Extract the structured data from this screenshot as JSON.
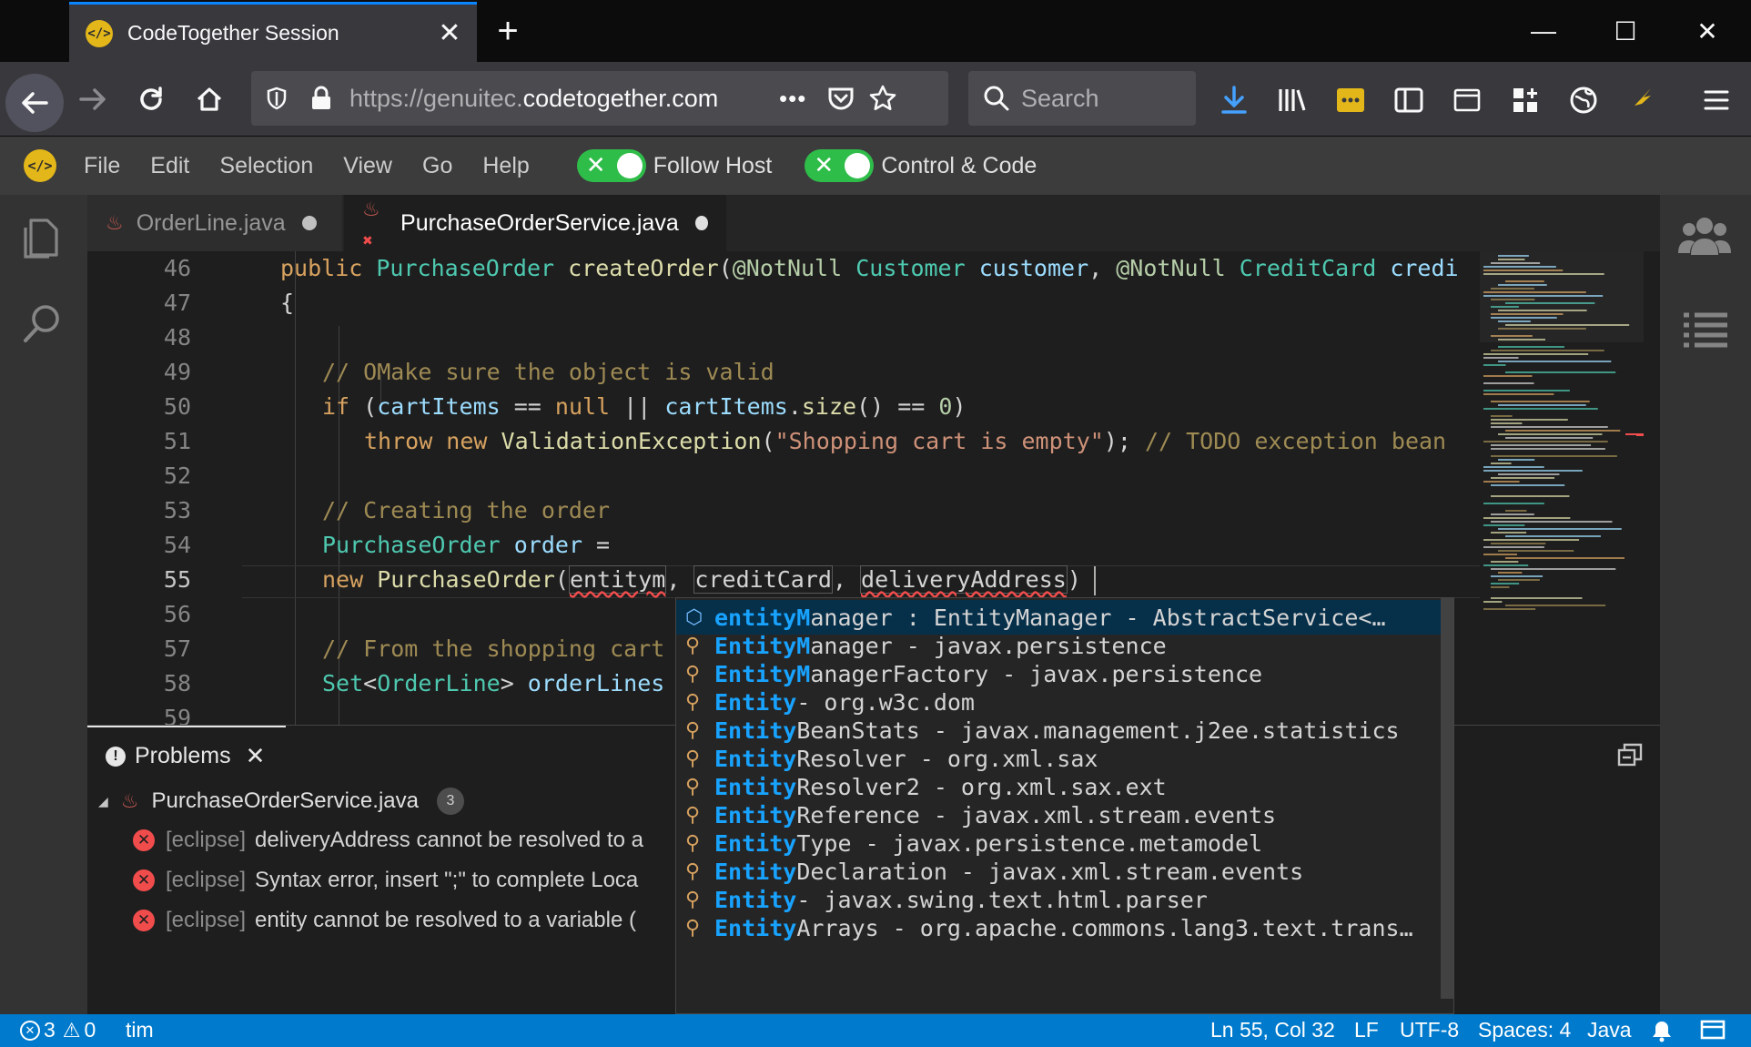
{
  "browser": {
    "tab_title": "CodeTogether Session",
    "tab_favicon": "</>",
    "close_glyph": "✕",
    "new_tab_glyph": "+",
    "url_prefix": "https://genuitec.",
    "url_domain": "codetogether.com",
    "search_placeholder": "Search",
    "page_actions": "•••",
    "window_min": "—",
    "window_max": "☐",
    "window_close": "✕"
  },
  "menubar": {
    "items": [
      "File",
      "Edit",
      "Selection",
      "View",
      "Go",
      "Help"
    ],
    "toggles": [
      {
        "label": "Follow Host",
        "glyph": "✕"
      },
      {
        "label": "Control & Code",
        "glyph": "✕"
      }
    ]
  },
  "editor": {
    "tabs": [
      {
        "label": "OrderLine.java",
        "active": false
      },
      {
        "label": "PurchaseOrderService.java",
        "active": true
      }
    ],
    "line_numbers": [
      "46",
      "47",
      "48",
      "49",
      "50",
      "51",
      "52",
      "53",
      "54",
      "55",
      "56",
      "57",
      "58",
      "59"
    ],
    "cursor_line": "55"
  },
  "suggestions": [
    {
      "match": "entityM",
      "rest": "anager : EntityManager - AbstractService<…",
      "selected": true
    },
    {
      "match": "EntityM",
      "rest": "anager - javax.persistence"
    },
    {
      "match": "EntityM",
      "rest": "anagerFactory - javax.persistence"
    },
    {
      "match": "Entity",
      "rest": " - org.w3c.dom"
    },
    {
      "match": "Entity",
      "rest": "BeanStats - javax.management.j2ee.statistics"
    },
    {
      "match": "Entity",
      "rest": "Resolver - org.xml.sax"
    },
    {
      "match": "Entity",
      "rest": "Resolver2 - org.xml.sax.ext"
    },
    {
      "match": "Entity",
      "rest": "Reference - javax.xml.stream.events"
    },
    {
      "match": "Entity",
      "rest": "Type - javax.persistence.metamodel"
    },
    {
      "match": "Entity",
      "rest": "Declaration - javax.xml.stream.events"
    },
    {
      "match": "Entity",
      "rest": " - javax.swing.text.html.parser"
    },
    {
      "match": "Entity",
      "rest": "Arrays - org.apache.commons.lang3.text.trans…"
    }
  ],
  "problems": {
    "tab_label": "Problems",
    "file": "PurchaseOrderService.java",
    "count": "3",
    "items": [
      {
        "source": "[eclipse]",
        "message": "deliveryAddress cannot be resolved to a"
      },
      {
        "source": "[eclipse]",
        "message": "Syntax error, insert \";\" to complete Loca"
      },
      {
        "source": "[eclipse]",
        "message": "entity cannot be resolved to a variable ("
      }
    ]
  },
  "statusbar": {
    "errors": "3",
    "warnings": "0",
    "user": "tim",
    "position": "Ln 55, Col 32",
    "eol": "LF",
    "encoding": "UTF-8",
    "indent": "Spaces: 4",
    "language": "Java"
  },
  "colors": {
    "accent": "#007acc",
    "toggle_on": "#2fbd4a",
    "error": "#f14c4c",
    "brand": "#e3b71a"
  }
}
